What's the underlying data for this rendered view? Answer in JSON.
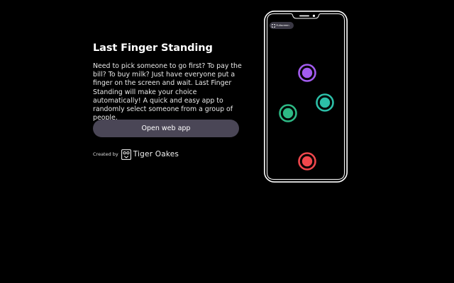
{
  "intro": {
    "title": "Last Finger Standing",
    "description": "Need to pick someone to go first? To pay the bill? To buy milk? Just have everyone put a finger on the screen and wait. Last Finger Standing will make your choice automatically! A quick and easy app to randomly select someone from a group of people."
  },
  "open_button": {
    "label": "Open web app"
  },
  "credit": {
    "label": "Created by",
    "name": "Tiger Oakes",
    "logo_icon": "tiger-oakes-logo-icon"
  },
  "phone_preview": {
    "fullscreen_button": {
      "label": "Fullscreen",
      "icon": "fullscreen-icon"
    },
    "touches": [
      {
        "color": "#a35cf0",
        "name": "purple"
      },
      {
        "color": "#2cbfa8",
        "name": "teal"
      },
      {
        "color": "#2db985",
        "name": "green"
      },
      {
        "color": "#f0474c",
        "name": "red"
      }
    ]
  },
  "colors": {
    "background": "#000000",
    "button": "#4a4656",
    "text": "#ffffff"
  }
}
